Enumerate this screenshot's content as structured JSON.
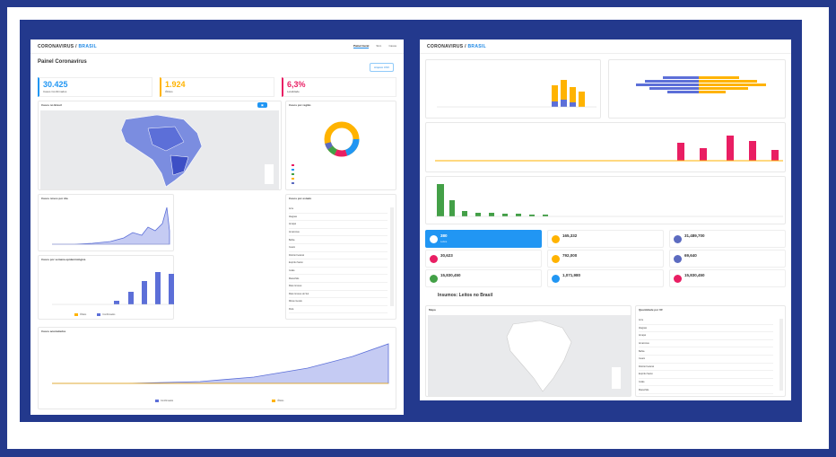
{
  "left": {
    "brand": "CORONAVIRUS",
    "brand_sub": "BRASIL",
    "tabs": [
      "Painel Geral",
      "Sínt.",
      "Casos"
    ],
    "page_title": "Painel Coronavírus",
    "stats": [
      {
        "value": "30.425",
        "label": "Casos Confirmados",
        "color": "#2196f3"
      },
      {
        "value": "1.924",
        "label": "Óbitos",
        "color": "#ffb300"
      },
      {
        "value": "6,3%",
        "label": "Letalidade",
        "color": "#e91e63"
      }
    ],
    "download_label": "Arquivo CSV",
    "map_card": {
      "title": "Casos no Brasil"
    },
    "region_card": {
      "title": "Casos por região"
    },
    "daily_card": {
      "title": "Casos novos por dia"
    },
    "epiweek_card": {
      "title": "Casos por semana epidemiológica"
    },
    "state_card": {
      "title": "Casos por estado"
    },
    "accum_card": {
      "title": "Casos acumulados"
    },
    "legend_confirmed": "Confirmados",
    "legend_deaths": "Óbitos",
    "state_rows": [
      "Acre",
      "Alagoas",
      "Amapá",
      "Amazonas",
      "Bahia",
      "Ceará",
      "Distrito Federal",
      "Espírito Santo",
      "Goiás",
      "Maranhão",
      "Mato Grosso",
      "Mato Grosso do Sul",
      "Minas Gerais",
      "Pará",
      "Paraíba",
      "Paraná",
      "Pernambuco"
    ]
  },
  "right": {
    "brand": "CORONAVIRUS",
    "brand_sub": "BRASIL",
    "section_title": "Insumos: Leitos no Brasil",
    "map_title": "Mapa",
    "uf_title": "Quantidade por UF",
    "tiles": [
      {
        "value": "380",
        "label": "Leitos",
        "color": "#2196f3"
      },
      {
        "value": "165,332",
        "label": "",
        "color": "#ffb300"
      },
      {
        "value": "31,489,700",
        "label": "",
        "color": "#5c6bc0"
      },
      {
        "value": "30,623",
        "label": "",
        "color": "#e91e63"
      },
      {
        "value": "792,000",
        "label": "",
        "color": "#ffb300"
      },
      {
        "value": "69,640",
        "label": "",
        "color": "#5c6bc0"
      },
      {
        "value": "15,830,450",
        "label": "",
        "color": "#43a047"
      },
      {
        "value": "1,071,980",
        "label": "",
        "color": "#2196f3"
      },
      {
        "value": "15,830,450",
        "label": "",
        "color": "#e91e63"
      }
    ],
    "uf_rows": [
      "Acre",
      "Alagoas",
      "Amapá",
      "Amazonas",
      "Bahia",
      "Ceará",
      "Distrito Federal",
      "Espírito Santo",
      "Goiás",
      "Maranhão",
      "Mato Grosso",
      "Mato Grosso do Sul"
    ]
  },
  "colors": {
    "bg": "#23398d",
    "blue": "#2196f3",
    "yellow": "#ffb300",
    "pink": "#e91e63",
    "green": "#43a047",
    "indigo": "#5c6bc0"
  }
}
